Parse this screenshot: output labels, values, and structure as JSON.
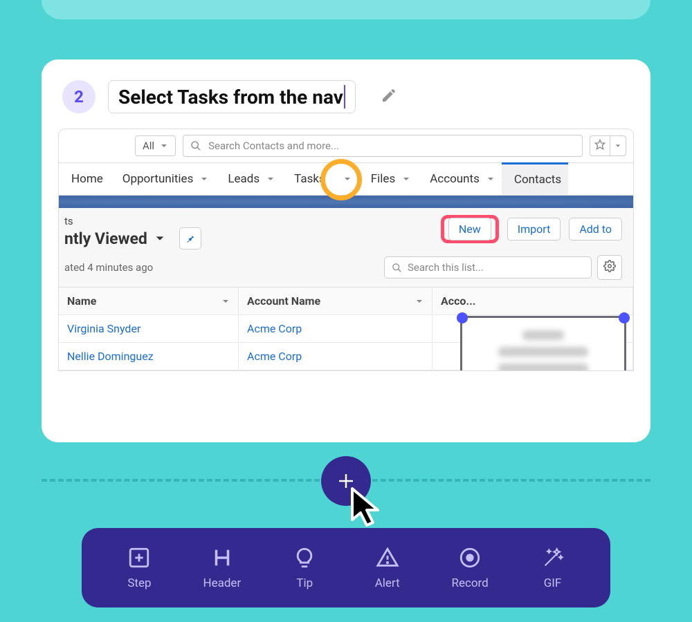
{
  "step": {
    "number": "2",
    "title": "Select Tasks from the nav"
  },
  "search_bar": {
    "scope": "All",
    "placeholder": "Search Contacts and more..."
  },
  "nav": {
    "items": [
      "Home",
      "Opportunities",
      "Leads",
      "Tasks",
      "Files",
      "Accounts",
      "Contacts"
    ],
    "highlighted": "Tasks",
    "active": "Contacts"
  },
  "list_view": {
    "object_partial": "ts",
    "name_partial": "ntly Viewed",
    "updated_partial": "ated 4 minutes ago",
    "search_placeholder": "Search this list..."
  },
  "actions": {
    "new": "New",
    "import": "Import",
    "add_to": "Add to"
  },
  "table": {
    "columns": [
      "Name",
      "Account Name",
      "Acco..."
    ],
    "rows": [
      {
        "name": "Virginia Snyder",
        "account": "Acme Corp"
      },
      {
        "name": "Nellie Dominguez",
        "account": "Acme Corp"
      }
    ]
  },
  "toolbar": {
    "items": [
      {
        "id": "step",
        "label": "Step"
      },
      {
        "id": "header",
        "label": "Header"
      },
      {
        "id": "tip",
        "label": "Tip"
      },
      {
        "id": "alert",
        "label": "Alert"
      },
      {
        "id": "record",
        "label": "Record"
      },
      {
        "id": "gif",
        "label": "GIF"
      }
    ]
  }
}
